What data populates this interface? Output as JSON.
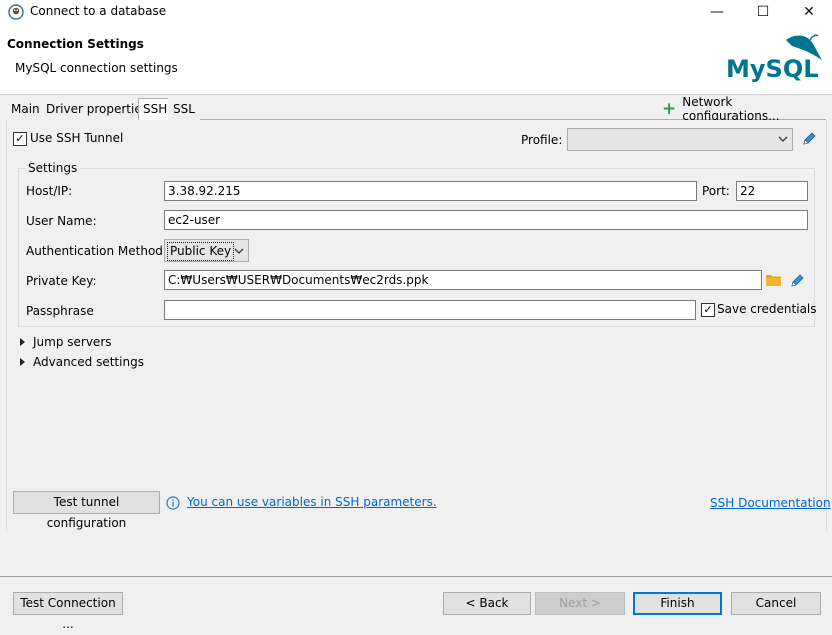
{
  "window": {
    "title": "Connect to a database",
    "min_glyph": "—",
    "max_glyph": "☐",
    "close_glyph": "✕"
  },
  "banner": {
    "heading": "Connection Settings",
    "subtitle": "MySQL connection settings",
    "logo_text": "MySQL"
  },
  "tabs": [
    {
      "label": "Main",
      "active": false
    },
    {
      "label": "Driver properties",
      "active": false
    },
    {
      "label": "SSH",
      "active": true
    },
    {
      "label": "SSL",
      "active": false
    }
  ],
  "network_configurations": {
    "label": "Network configurations..."
  },
  "ssh": {
    "use_tunnel_label": "Use SSH Tunnel",
    "use_tunnel_checked": true,
    "profile_label": "Profile:",
    "profile_value": "",
    "settings_group_label": "Settings",
    "host_label": "Host/IP:",
    "host_value": "3.38.92.215",
    "port_label": "Port:",
    "port_value": "22",
    "user_label": "User Name:",
    "user_value": "ec2-user",
    "auth_label": "Authentication Method:",
    "auth_value": "Public Key",
    "private_key_label": "Private Key:",
    "private_key_value": "C:₩Users₩USER₩Documents₩ec2rds.ppk",
    "passphrase_label": "Passphrase",
    "passphrase_value": "",
    "save_credentials_label": "Save credentials",
    "save_credentials_checked": true,
    "jump_servers_label": "Jump servers",
    "advanced_settings_label": "Advanced settings",
    "test_tunnel_label": "Test tunnel configuration",
    "variables_hint": "You can use variables in SSH parameters.",
    "ssh_documentation": "SSH Documentation"
  },
  "footer": {
    "test_connection": "Test Connection ...",
    "back": "< Back",
    "next": "Next >",
    "finish": "Finish",
    "cancel": "Cancel"
  },
  "colors": {
    "accent": "#0078d7",
    "link": "#0066cc",
    "mysql_blue": "#00758f",
    "mysql_orange": "#f29111",
    "folder": "#e8a317",
    "plus": "#2e9e3a"
  }
}
